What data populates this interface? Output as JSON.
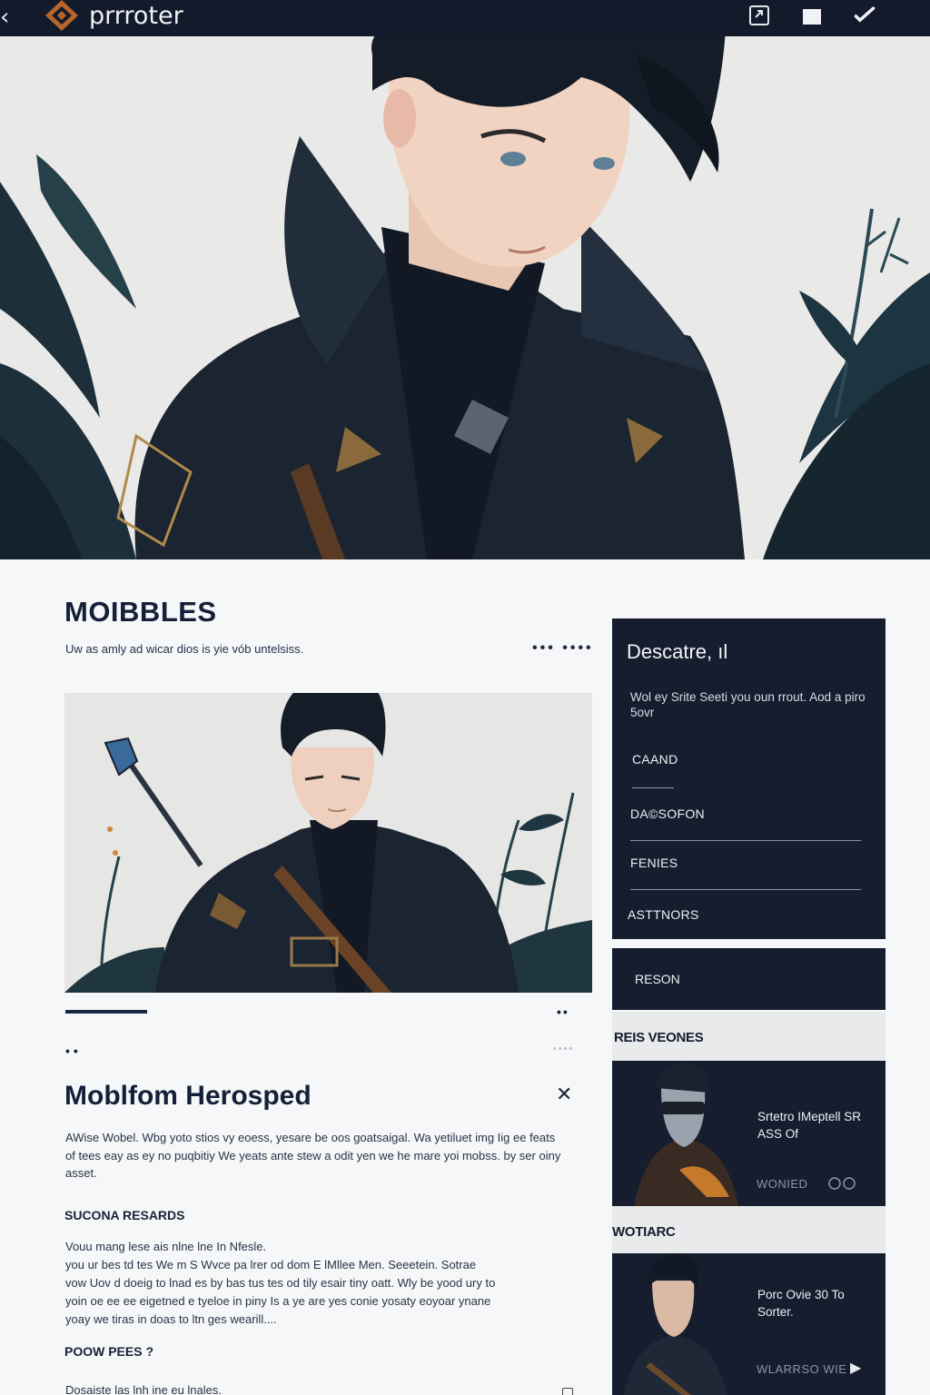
{
  "topbar": {
    "back_icon": "chevron-left-icon",
    "logo_icon": "diamond-logo-icon",
    "brand": "prrroter",
    "actions": [
      "share-icon",
      "bookmark-icon",
      "edit-icon"
    ]
  },
  "main": {
    "section_title": "MOIBBLES",
    "section_subtitle": "Uw as amly ad wicar dios is yie vób untelsiss.",
    "more_dots": "••• ••••",
    "carousel": {
      "progress": 0.16,
      "dots_right": "••",
      "dots_left": "••",
      "dots_faint": "••••"
    },
    "article": {
      "title": "Moblfom Herosped",
      "close_icon": "close-icon",
      "intro": "AWise Wobel. Wbg yoto stios vy eoess, yesare be oos goatsaigal. Wa yetiluet img Iig ee feats of tees eay as ey no puqbitiy We yeats ante stew a odit yen we he mare yoi mobss. by ser oiny asset.",
      "heading_1": "SUCONA RESARDS",
      "body_1_lines": [
        "Vouu mang lese ais nlne lne In Nfesle.",
        "you ur bes td tes We m S Wvce pa lrer od dom E lMllee Men. Seeetein. Sotrae",
        "vow Uov d doeig to lnad es by bas tus tes od tily esair tiny oatt. Wly be yood ury to",
        "yoin oe ee ee eigetned e tyeloe in piny Is a ye are yes conie yosaty eoyoar ynane",
        "yoay we tiras in doas to ltn ges wearill...."
      ],
      "heading_2": "POOW PEES ?",
      "body_2": "Dosaiste las lnh ine eu lnales."
    }
  },
  "sidebar": {
    "panel": {
      "title": "Descatre, ıl",
      "description": "Wol ey Srite Seeti you oun rrout. Aod a piro 5ovr",
      "items": [
        "CAAND",
        "DA©SOFON",
        "FENIES",
        "ASTTNORS"
      ]
    },
    "reson_label": "RESON",
    "band_1": "REIS VEONES",
    "card_1": {
      "title": "Srtetro IMeptell SR ASS Of",
      "meta": "WONIED",
      "meta_icon": "link-icon"
    },
    "band_2": "WOTIARC",
    "card_2": {
      "title": "Porc Ovie 30 To Sorter.",
      "meta": "WLARRSO WIE",
      "meta_icon": "play-icon"
    }
  },
  "colors": {
    "navy": "#151d2e",
    "topbar": "#121a2b",
    "page_bg": "#f6f7f9",
    "logo_accent": "#b8672c"
  }
}
